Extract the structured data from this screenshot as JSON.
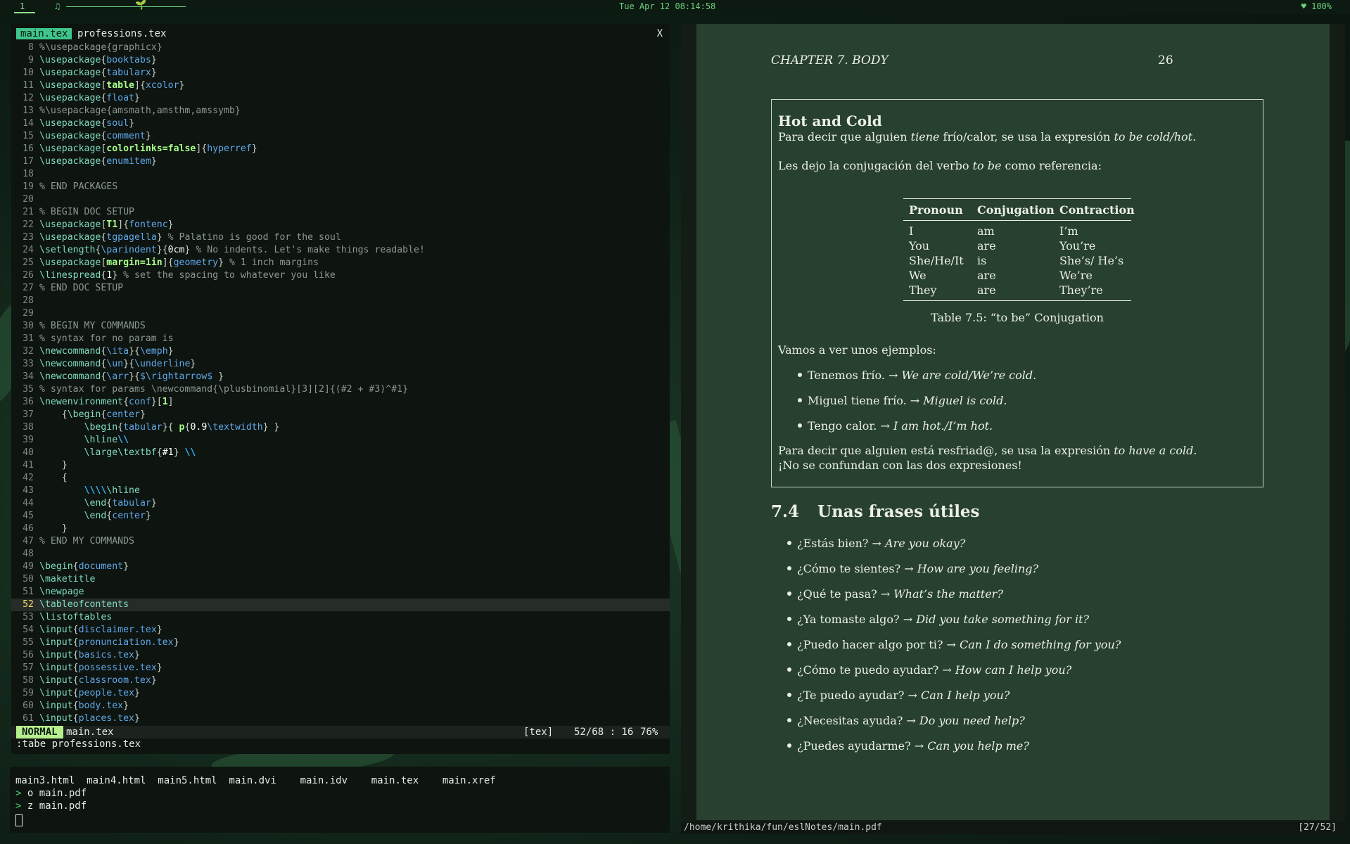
{
  "topbar": {
    "workspace": "1",
    "music_icon": "music-note-icon",
    "plant_icon": "sprout-icon",
    "clock": "Tue Apr 12  08:14:58",
    "battery": "♥ 100%"
  },
  "vim": {
    "tab_active": "main.tex",
    "tab_inactive": "professions.tex",
    "tab_close": "X",
    "lines": [
      {
        "n": "8",
        "html": "<span class='c'>%\\usepackage{graphicx}</span>"
      },
      {
        "n": "9",
        "html": "<span class='k'>\\usepackage</span>{<span class='a'>booktabs</span>}"
      },
      {
        "n": "10",
        "html": "<span class='k'>\\usepackage</span>{<span class='a'>tabularx</span>}"
      },
      {
        "n": "11",
        "html": "<span class='k'>\\usepackage</span>[<span class='b'>table</span>]{<span class='a'>xcolor</span>}"
      },
      {
        "n": "12",
        "html": "<span class='k'>\\usepackage</span>{<span class='a'>float</span>}"
      },
      {
        "n": "13",
        "html": "<span class='c'>%\\usepackage{amsmath,amsthm,amssymb}</span>"
      },
      {
        "n": "14",
        "html": "<span class='k'>\\usepackage</span>{<span class='a'>soul</span>}"
      },
      {
        "n": "15",
        "html": "<span class='k'>\\usepackage</span>{<span class='a'>comment</span>}"
      },
      {
        "n": "16",
        "html": "<span class='k'>\\usepackage</span>[<span class='b'>colorlinks=false</span>]{<span class='a'>hyperref</span>}"
      },
      {
        "n": "17",
        "html": "<span class='k'>\\usepackage</span>{<span class='a'>enumitem</span>}"
      },
      {
        "n": "18",
        "html": ""
      },
      {
        "n": "19",
        "html": "<span class='c'>% END PACKAGES</span>"
      },
      {
        "n": "20",
        "html": ""
      },
      {
        "n": "21",
        "html": "<span class='c'>% BEGIN DOC SETUP</span>"
      },
      {
        "n": "22",
        "html": "<span class='k'>\\usepackage</span>[<span class='b'>T1</span>]{<span class='a'>fontenc</span>}"
      },
      {
        "n": "23",
        "html": "<span class='k'>\\usepackage</span>{<span class='a'>tgpagella</span>} <span class='c'>% Palatino is good for the soul</span>"
      },
      {
        "n": "24",
        "html": "<span class='k'>\\setlength</span>{<span class='a'>\\parindent</span>}{<span class='w'>0cm</span>} <span class='c'>% No indents. Let's make things readable!</span>"
      },
      {
        "n": "25",
        "html": "<span class='k'>\\usepackage</span>[<span class='b'>margin=1in</span>]{<span class='a'>geometry</span>} <span class='c'>% 1 inch margins</span>"
      },
      {
        "n": "26",
        "html": "<span class='k'>\\linespread</span>{<span class='w'>1</span>} <span class='c'>% set the spacing to whatever you like</span>"
      },
      {
        "n": "27",
        "html": "<span class='c'>% END DOC SETUP</span>"
      },
      {
        "n": "28",
        "html": ""
      },
      {
        "n": "29",
        "html": ""
      },
      {
        "n": "30",
        "html": "<span class='c'>% BEGIN MY COMMANDS</span>"
      },
      {
        "n": "31",
        "html": "<span class='c'>% syntax for no param is</span>"
      },
      {
        "n": "32",
        "html": "<span class='k'>\\newcommand</span>{<span class='a'>\\ita</span>}{<span class='a'>\\emph</span>}"
      },
      {
        "n": "33",
        "html": "<span class='k'>\\newcommand</span>{<span class='a'>\\un</span>}{<span class='a'>\\underline</span>}"
      },
      {
        "n": "34",
        "html": "<span class='k'>\\newcommand</span>{<span class='a'>\\arr</span>}{<span class='a'>$\\rightarrow$ </span>}"
      },
      {
        "n": "35",
        "html": "<span class='c'>% syntax for params \\newcommand{\\plusbinomial}[3][2]{(#2 + #3)^#1}</span>"
      },
      {
        "n": "36",
        "html": "<span class='k'>\\newenvironment</span>{<span class='a'>conf</span>}[<span class='b'>1</span>]"
      },
      {
        "n": "37",
        "html": "    {<span class='k'>\\begin</span>{<span class='a'>center</span>}"
      },
      {
        "n": "38",
        "html": "        <span class='k'>\\begin</span>{<span class='a'>tabular</span>}{ <span class='b'>p</span>{<span class='w'>0.9</span><span class='a'>\\textwidth</span>} }"
      },
      {
        "n": "39",
        "html": "        <span class='k'>\\hline</span><span class='bs'>\\\\</span>"
      },
      {
        "n": "40",
        "html": "        <span class='k'>\\large\\textbf</span>{<span class='w'>#1</span>} <span class='bs'>\\\\</span>"
      },
      {
        "n": "41",
        "html": "    }"
      },
      {
        "n": "42",
        "html": "    {"
      },
      {
        "n": "43",
        "html": "        <span class='bs'>\\\\\\\\</span><span class='k'>\\hline</span>"
      },
      {
        "n": "44",
        "html": "        <span class='k'>\\end</span>{<span class='a'>tabular</span>}"
      },
      {
        "n": "45",
        "html": "        <span class='k'>\\end</span>{<span class='a'>center</span>}"
      },
      {
        "n": "46",
        "html": "    }"
      },
      {
        "n": "47",
        "html": "<span class='c'>% END MY COMMANDS</span>"
      },
      {
        "n": "48",
        "html": ""
      },
      {
        "n": "49",
        "html": "<span class='k'>\\begin</span>{<span class='a'>document</span>}"
      },
      {
        "n": "50",
        "html": "<span class='k'>\\maketitle</span>"
      },
      {
        "n": "51",
        "html": "<span class='k'>\\newpage</span>"
      },
      {
        "n": "52",
        "html": "<span class='k'>\\tableofcontents</span>",
        "cur": true
      },
      {
        "n": "53",
        "html": "<span class='k'>\\listoftables</span>"
      },
      {
        "n": "54",
        "html": "<span class='k'>\\input</span>{<span class='a'>disclaimer.tex</span>}"
      },
      {
        "n": "55",
        "html": "<span class='k'>\\input</span>{<span class='a'>pronunciation.tex</span>}"
      },
      {
        "n": "56",
        "html": "<span class='k'>\\input</span>{<span class='a'>basics.tex</span>}"
      },
      {
        "n": "57",
        "html": "<span class='k'>\\input</span>{<span class='a'>possessive.tex</span>}"
      },
      {
        "n": "58",
        "html": "<span class='k'>\\input</span>{<span class='a'>classroom.tex</span>}"
      },
      {
        "n": "59",
        "html": "<span class='k'>\\input</span>{<span class='a'>people.tex</span>}"
      },
      {
        "n": "60",
        "html": "<span class='k'>\\input</span>{<span class='a'>body.tex</span>}"
      },
      {
        "n": "61",
        "html": "<span class='k'>\\input</span>{<span class='a'>places.tex</span>}"
      }
    ],
    "status": {
      "mode": "NORMAL",
      "file": "main.tex",
      "filetype": "[tex]",
      "position": "52/68 : 16",
      "percent": "76%"
    },
    "cmdline": ":tabe professions.tex"
  },
  "terminal": {
    "files": "main3.html  main4.html  main5.html  main.dvi    main.idv    main.tex    main.xref",
    "prompt_symbol": ">",
    "cmd1": "o main.pdf",
    "cmd2": "z main.pdf"
  },
  "pdf": {
    "header": "CHAPTER 7.  BODY",
    "page_number": "26",
    "box_title": "Hot and Cold",
    "box_p1": "Para decir que alguien <em>tiene</em> frío/calor, se usa la expresión <em>to be cold/hot</em>.",
    "box_p2": "Les dejo la conjugación del verbo <em>to be</em> como referencia:",
    "table_headers": [
      "Pronoun",
      "Conjugation",
      "Contraction"
    ],
    "table_rows": [
      [
        "I",
        "am",
        "I’m"
      ],
      [
        "You",
        "are",
        "You’re"
      ],
      [
        "She/He/It",
        "is",
        "She’s/ He’s"
      ],
      [
        "We",
        "are",
        "We’re"
      ],
      [
        "They",
        "are",
        "They’re"
      ]
    ],
    "caption": "Table 7.5: “to be” Conjugation",
    "examples_intro": "Vamos a ver unos ejemplos:",
    "examples": [
      "Tenemos frío. → <em>We are cold/We’re cold.</em>",
      "Miguel tiene frío. → <em>Miguel is cold.</em>",
      "Tengo calor. → <em>I am hot./I’m hot.</em>"
    ],
    "box_p4_line1": "Para decir que alguien está resfriad@, se usa la expresión <em>to have a cold</em>.",
    "box_p4_line2": "¡No se confundan con las dos expresiones!",
    "section_number": "7.4",
    "section_title": "Unas frases útiles",
    "phrases": [
      "¿Estás bien? → <em>Are you okay?</em>",
      "¿Cómo te sientes? → <em>How are you feeling?</em>",
      "¿Qué te pasa? → <em>What’s the matter?</em>",
      "¿Ya tomaste algo? → <em>Did you take something for it?</em>",
      "¿Puedo hacer algo por ti? → <em>Can I do something for you?</em>",
      "¿Cómo te puedo ayudar? → <em>How can I help you?</em>",
      "¿Te puedo ayudar? → <em>Can I help you?</em>",
      "¿Necesitas ayuda? → <em>Do you need help?</em>",
      "¿Puedes ayudarme? → <em>Can you help me?</em>"
    ],
    "file_path": "/home/krithika/fun/eslNotes/main.pdf",
    "page_indicator": "[27/52]"
  },
  "colors": {
    "accent_green": "#3fc58b",
    "mode_green": "#b8ef8e",
    "page_bg": "#27402f"
  }
}
